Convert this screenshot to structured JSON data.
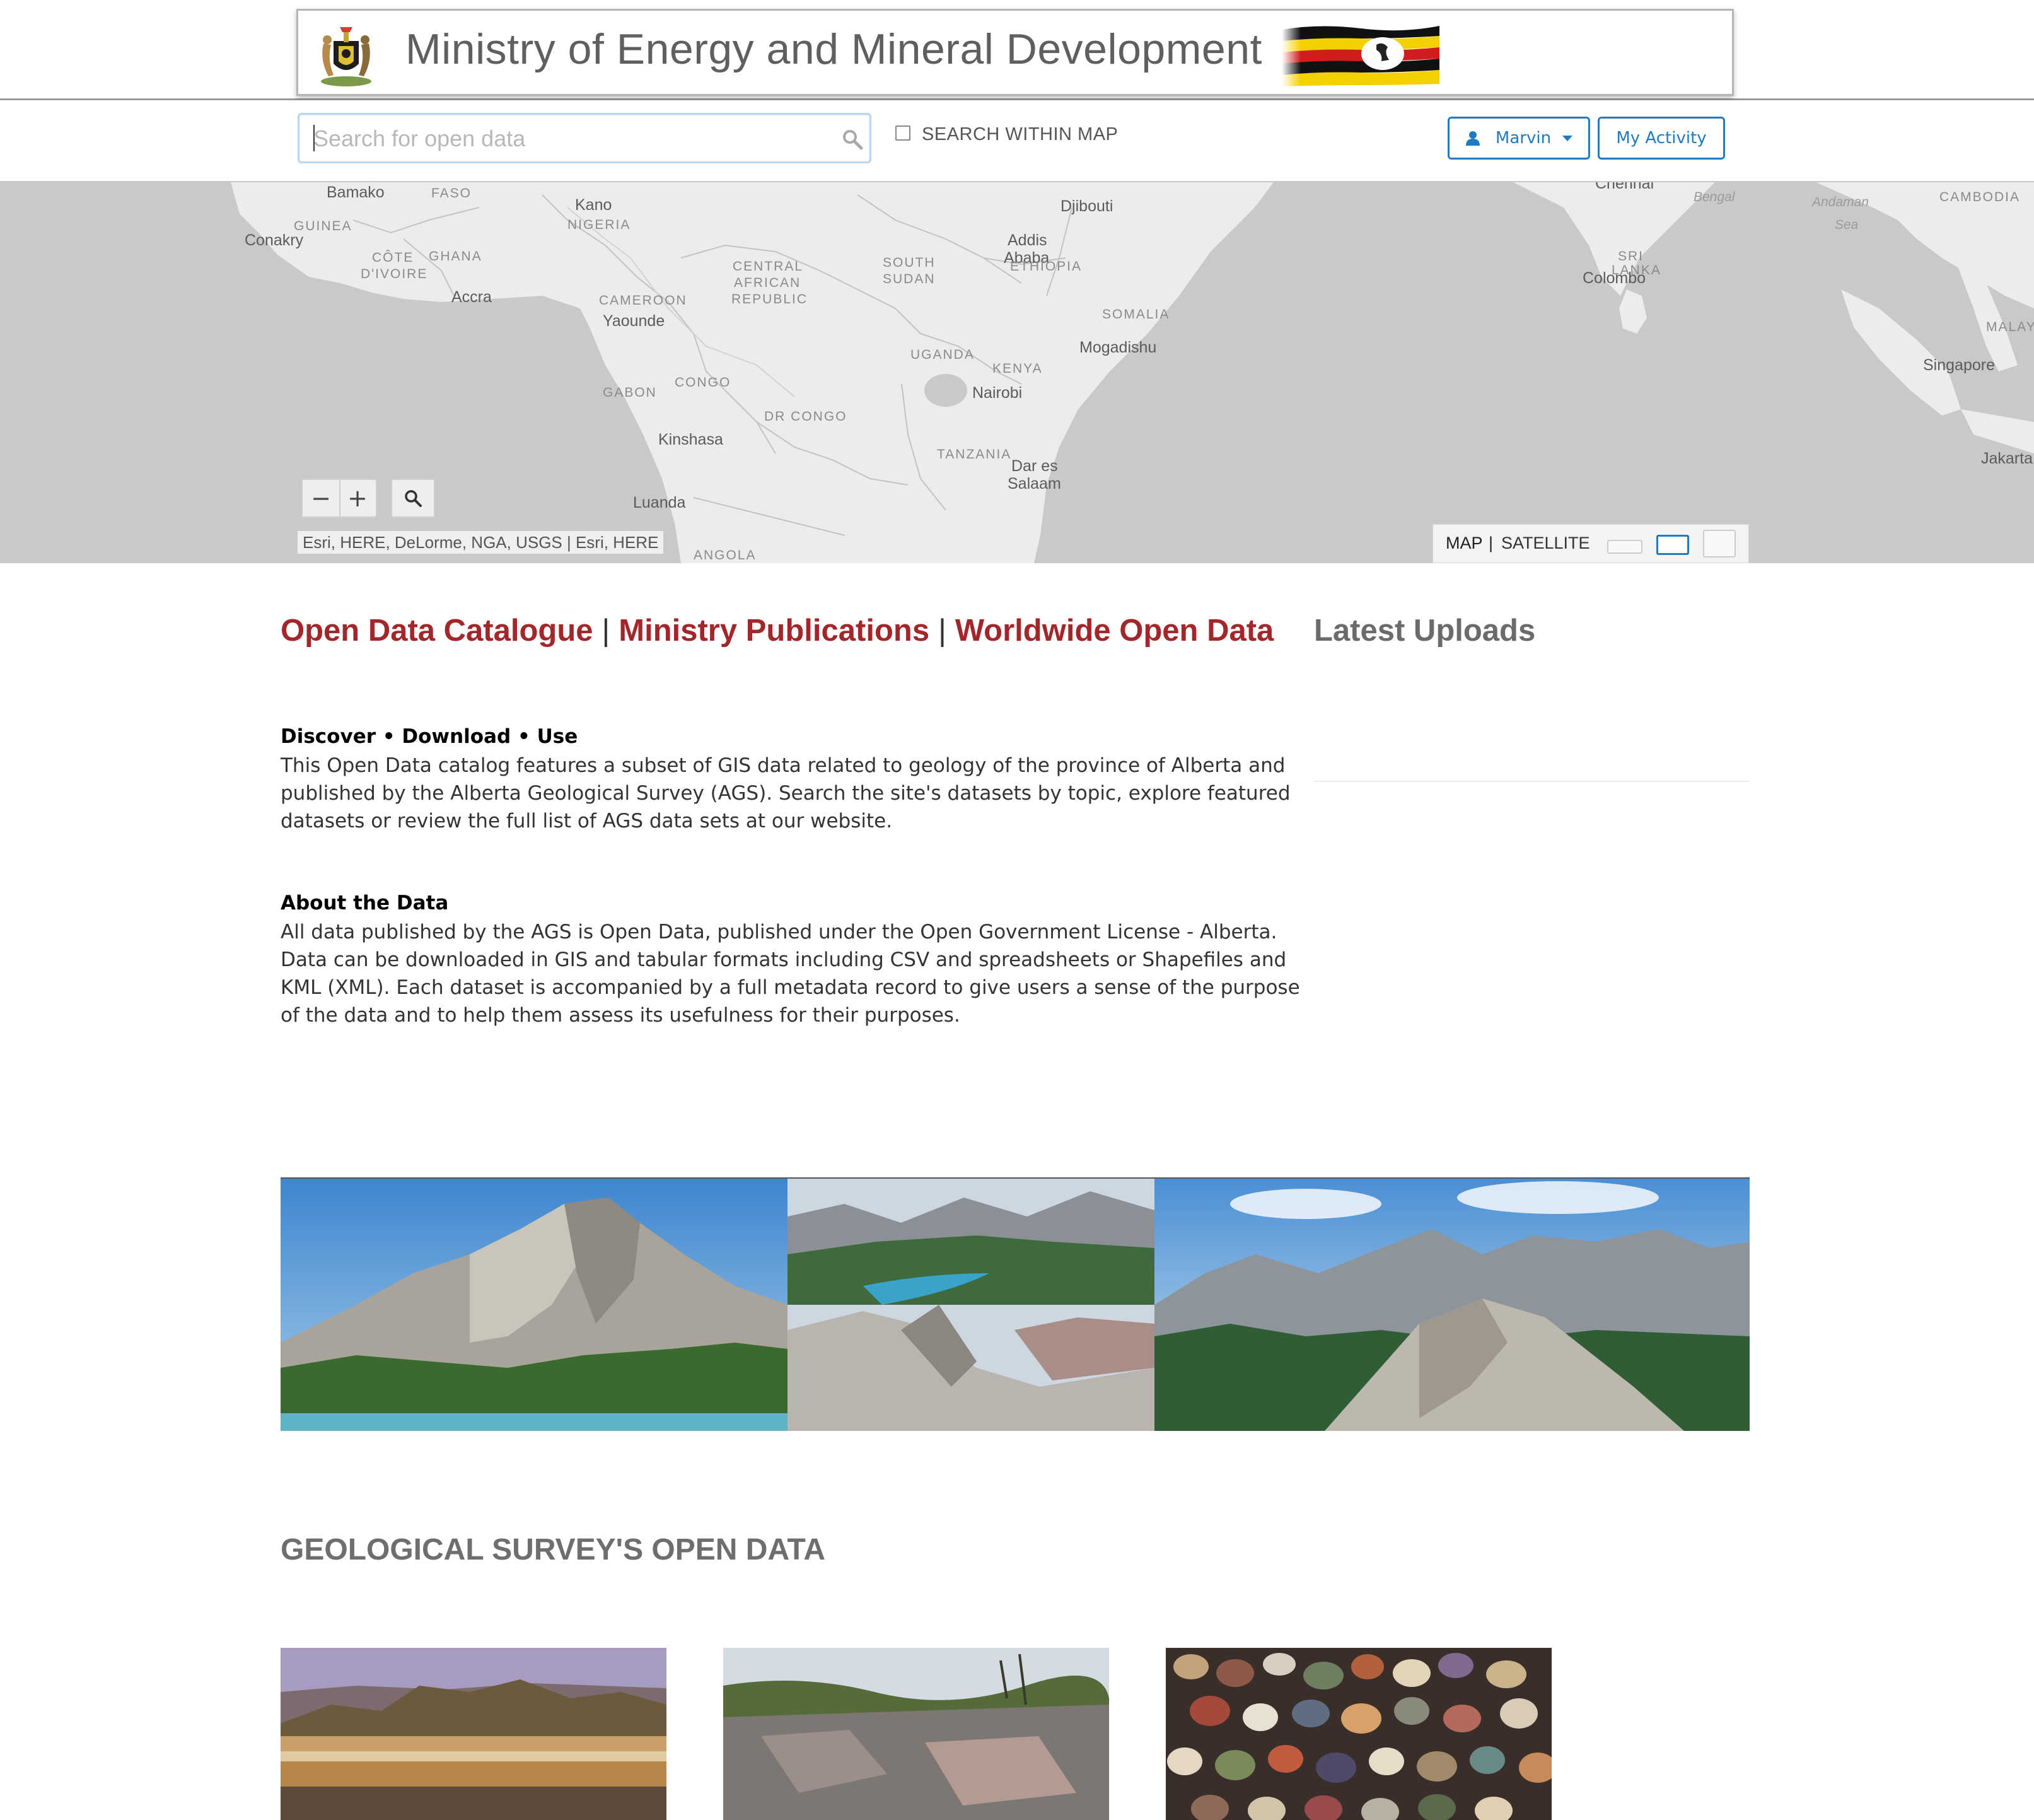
{
  "header": {
    "title": "Ministry of Energy and Mineral Development",
    "logo_icon": "coat-of-arms-icon",
    "flag_icon": "uganda-flag-icon"
  },
  "search": {
    "placeholder": "Search for open data",
    "value": "",
    "within_map_label": "SEARCH WITHIN MAP",
    "within_map_checked": false
  },
  "user_menu": {
    "user_label": "Marvin",
    "activity_label": "My Activity"
  },
  "map": {
    "labels": {
      "bamako": "Bamako",
      "faso": "FASO",
      "conakry": "Conakry",
      "guinea": "GUINEA",
      "cote_line1": "CÔTE",
      "cote_line2": "D'IVOIRE",
      "ghana": "GHANA",
      "accra": "Accra",
      "kano": "Kano",
      "nigeria": "NIGERIA",
      "cameroon": "CAMEROON",
      "yaounde": "Yaounde",
      "gabon": "GABON",
      "congo": "CONGO",
      "car_line1": "CENTRAL",
      "car_line2": "AFRICAN",
      "car_line3": "REPUBLIC",
      "south_sudan_line1": "SOUTH",
      "south_sudan_line2": "SUDAN",
      "dr_congo": "DR CONGO",
      "kinshasa": "Kinshasa",
      "luanda": "Luanda",
      "angola": "ANGOLA",
      "uganda": "UGANDA",
      "kenya": "KENYA",
      "nairobi": "Nairobi",
      "tanzania": "TANZANIA",
      "dar_line1": "Dar es",
      "dar_line2": "Salaam",
      "djibouti": "Djibouti",
      "addis_line1": "Addis",
      "addis_line2": "Ababa",
      "ethiopia": "ETHIOPIA",
      "somalia": "SOMALIA",
      "mogadishu": "Mogadishu",
      "chennai": "Chennai",
      "bengal": "Bengal",
      "andaman_line1": "Andaman",
      "andaman_line2": "Sea",
      "sri_line1": "SRI",
      "sri_line2": "LANKA",
      "colombo": "Colombo",
      "cambodia": "CAMBODIA",
      "malay": "MALAY",
      "singapore": "Singapore",
      "jakarta": "Jakarta"
    },
    "zoom_out": "−",
    "zoom_in": "+",
    "attribution": "Esri, HERE, DeLorme, NGA, USGS | Esri, HERE",
    "basemap_map": "MAP",
    "basemap_separator": "|",
    "basemap_satellite": "SATELLITE"
  },
  "nav": {
    "catalogue": "Open Data Catalogue",
    "publications": "Ministry Publications",
    "worldwide": "Worldwide Open Data",
    "separator": "|"
  },
  "latest_uploads": {
    "title": "Latest Uploads"
  },
  "intro": {
    "discover_heading": "Discover • Download • Use",
    "discover_text": "This Open Data catalog features a subset of GIS data related to geology of the province of Alberta and published by the Alberta Geological Survey (AGS). Search the site's datasets by topic, explore featured datasets or review the full list of AGS data sets at our website.",
    "about_heading": "About the Data",
    "about_text": "All data published by the AGS is Open Data, published under the Open Government License - Alberta. Data can be downloaded in GIS and tabular formats including CSV and spreadsheets or Shapefiles and KML (XML). Each dataset is accompanied by a full metadata record to give users a sense of the purpose of the data and to help them assess its usefulness for their purposes."
  },
  "open_data": {
    "title": "GEOLOGICAL SURVEY'S OPEN DATA"
  }
}
